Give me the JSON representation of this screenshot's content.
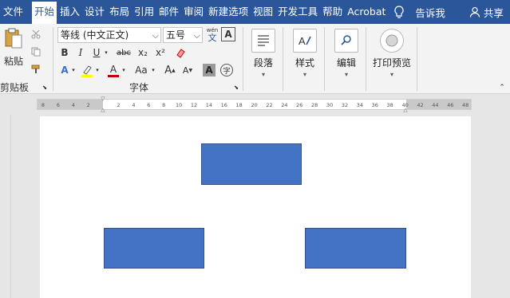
{
  "tabs": {
    "file": "文件",
    "items": [
      "开始",
      "插入",
      "设计",
      "布局",
      "引用",
      "邮件",
      "审阅",
      "新建选项",
      "视图",
      "开发工具",
      "帮助",
      "Acrobat"
    ],
    "tell_me": "告诉我",
    "share": "共享"
  },
  "clipboard": {
    "paste": "粘贴",
    "group_label": "剪贴板"
  },
  "font": {
    "family": "等线 (中文正文)",
    "size": "五号",
    "wen": "wén",
    "wen_char": "文",
    "a_box": "A",
    "bold": "B",
    "italic": "I",
    "underline": "U",
    "strike": "abc",
    "subscript": "x₂",
    "superscript": "x²",
    "text_effects": "A",
    "font_color": "A",
    "case": "Aa",
    "grow": "A",
    "shrink": "A",
    "char_shading": "A",
    "enclose": "字",
    "group_label": "字体"
  },
  "paragraph": {
    "label": "段落"
  },
  "styles": {
    "label": "样式"
  },
  "editing": {
    "label": "编辑"
  },
  "print_preview": {
    "label": "打印预览"
  },
  "ruler": {
    "labels": [
      "8",
      "6",
      "4",
      "2",
      "",
      "2",
      "4",
      "6",
      "8",
      "10",
      "12",
      "14",
      "16",
      "18",
      "20",
      "22",
      "24",
      "26",
      "28",
      "30",
      "32",
      "34",
      "36",
      "38",
      "40",
      "42",
      "44",
      "46",
      "48"
    ]
  },
  "colors": {
    "tab_bar": "#2b579a",
    "shape_fill": "#4472c4",
    "shape_border": "#2f528f",
    "highlight": "#ffff00",
    "font_red": "#c00000"
  },
  "document": {
    "shapes": [
      "rect-top",
      "rect-bottom-left",
      "rect-bottom-right"
    ]
  }
}
